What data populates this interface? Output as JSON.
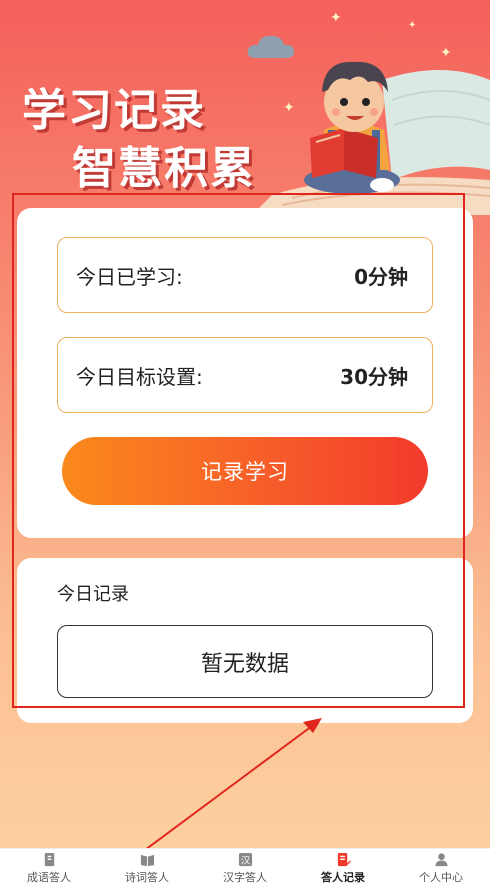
{
  "hero": {
    "title_line1": "学习记录",
    "title_line2": "智慧积累"
  },
  "stats": {
    "today_label": "今日已学习:",
    "today_value": "0分钟",
    "goal_label": "今日目标设置:",
    "goal_value": "30分钟"
  },
  "record_button": "记录学习",
  "log": {
    "title": "今日记录",
    "empty": "暂无数据"
  },
  "tabs": [
    {
      "label": "成语答人",
      "icon": "book-icon"
    },
    {
      "label": "诗词答人",
      "icon": "open-book-icon"
    },
    {
      "label": "汉字答人",
      "icon": "han-char-icon"
    },
    {
      "label": "答人记录",
      "icon": "note-edit-icon",
      "active": true
    },
    {
      "label": "个人中心",
      "icon": "person-icon"
    }
  ],
  "colors": {
    "accent": "#f33a2b",
    "button_start": "#fb8a1c",
    "stat_border": "#f0b160",
    "annotation": "#e0261c",
    "bg_top": "#f4605a",
    "bg_bottom": "#fdd3a2"
  }
}
